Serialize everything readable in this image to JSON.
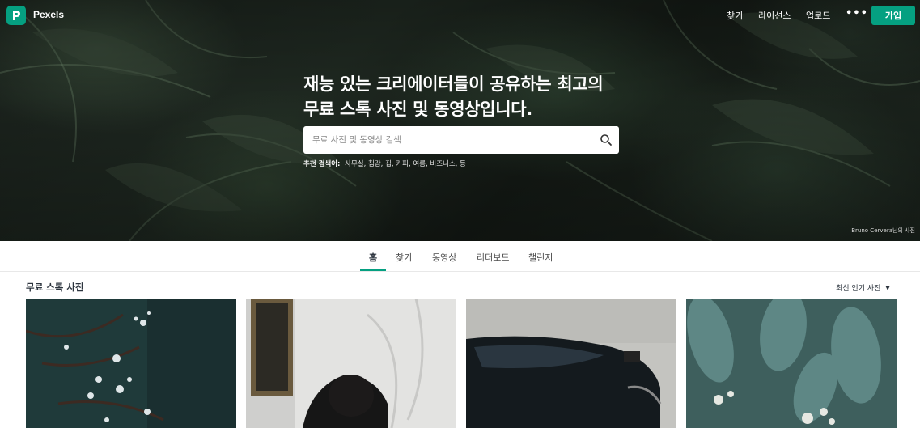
{
  "brand": {
    "name": "Pexels",
    "color": "#05a081"
  },
  "topnav": {
    "links": [
      "찾기",
      "라이선스",
      "업로드"
    ],
    "more": "•••",
    "join_label": "가입"
  },
  "hero": {
    "headline": "재능 있는 크리에이터들이 공유하는 최고의 무료 스톡 사진 및 동영상입니다.",
    "search_placeholder": "무료 사진 및 동영상 검색",
    "suggest_label": "추천 검색어:",
    "suggest_terms": "사무실, 침감, 집, 커피, 여름, 비즈니스, 등",
    "credit": "Bruno Cervera님의 사진"
  },
  "tabs": [
    {
      "label": "홈",
      "active": true
    },
    {
      "label": "찾기",
      "active": false
    },
    {
      "label": "동영상",
      "active": false
    },
    {
      "label": "리더보드",
      "active": false
    },
    {
      "label": "챌린지",
      "active": false
    }
  ],
  "section": {
    "title": "무료 스톡 사진",
    "sort_label": "최신 인기 사진"
  },
  "photos": [
    "photo-flowers",
    "photo-portrait",
    "photo-car",
    "photo-plant"
  ]
}
